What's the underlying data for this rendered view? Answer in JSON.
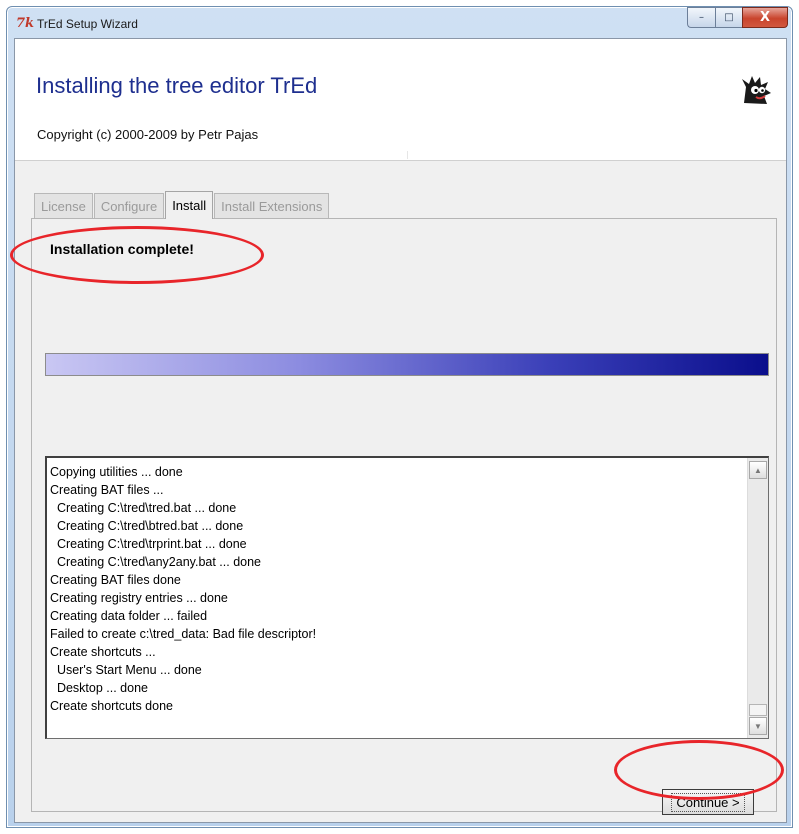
{
  "window": {
    "title": "TrEd Setup Wizard",
    "app_icon_glyph": "7k",
    "controls": {
      "minimize": "–",
      "maximize": "□",
      "close": "X"
    }
  },
  "header": {
    "title": "Installing the tree editor TrEd",
    "copyright": "Copyright (c) 2000-2009 by Petr Pajas",
    "mascot_icon": "tred-mascot-icon"
  },
  "tabs": [
    {
      "label": "License",
      "active": false
    },
    {
      "label": "Configure",
      "active": false
    },
    {
      "label": "Install",
      "active": true
    },
    {
      "label": "Install Extensions",
      "active": false
    }
  ],
  "install": {
    "status": "Installation complete!",
    "progress_percent": 100,
    "log": [
      "Copying utilities ... done",
      "Creating BAT files ...",
      "  Creating C:\\tred\\tred.bat ... done",
      "  Creating C:\\tred\\btred.bat ... done",
      "  Creating C:\\tred\\trprint.bat ... done",
      "  Creating C:\\tred\\any2any.bat ... done",
      "Creating BAT files done",
      "Creating registry entries ... done",
      "Creating data folder ... failed",
      "Failed to create c:\\tred_data: Bad file descriptor!",
      "Create shortcuts ...",
      "  User's Start Menu ... done",
      "  Desktop ... done",
      "Create shortcuts done"
    ],
    "continue_label": "Continue >"
  },
  "colors": {
    "title_blue": "#1e2f8f",
    "progress_start": "#c9c7f3",
    "progress_end": "#0a0e8c",
    "annotation_red": "#e8252a"
  }
}
